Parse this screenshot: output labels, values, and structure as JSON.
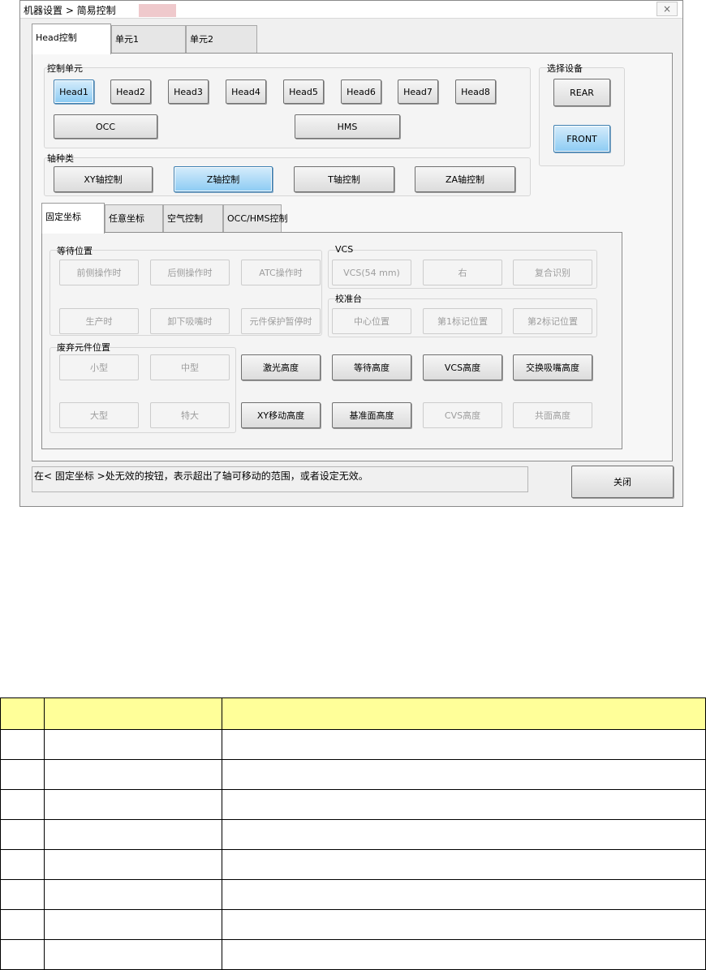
{
  "window": {
    "title": "机器设置 > 简易控制",
    "close_icon": "×"
  },
  "top_tabs": [
    "Head控制",
    "单元1",
    "单元2"
  ],
  "control_unit": {
    "label": "控制单元",
    "heads": [
      "Head1",
      "Head2",
      "Head3",
      "Head4",
      "Head5",
      "Head6",
      "Head7",
      "Head8"
    ],
    "occ": "OCC",
    "hms": "HMS"
  },
  "select_device": {
    "label": "选择设备",
    "rear": "REAR",
    "front": "FRONT"
  },
  "axis_group": {
    "label": "轴种类",
    "buttons": [
      "XY轴控制",
      "Z轴控制",
      "T轴控制",
      "ZA轴控制"
    ]
  },
  "inner_tabs": [
    "固定坐标",
    "任意坐标",
    "空气控制",
    "OCC/HMS控制"
  ],
  "wait_position": {
    "label": "等待位置",
    "buttons": [
      "前侧操作时",
      "后侧操作时",
      "ATC操作时",
      "生产时",
      "卸下吸嘴时",
      "元件保护暂停时"
    ]
  },
  "vcs": {
    "label": "VCS",
    "buttons": [
      "VCS(54 mm)",
      "右",
      "复合识别"
    ]
  },
  "calibration": {
    "label": "校准台",
    "buttons": [
      "中心位置",
      "第1标记位置",
      "第2标记位置"
    ]
  },
  "discard": {
    "label": "废弃元件位置",
    "buttons": [
      "小型",
      "中型",
      "大型",
      "特大"
    ]
  },
  "height_buttons": [
    "激光高度",
    "等待高度",
    "VCS高度",
    "交换吸嘴高度",
    "XY移动高度",
    "基准面高度",
    "CVS高度",
    "共面高度"
  ],
  "status_text": "在< 固定坐标 >处无效的按钮，表示超出了轴可移动的范围，或者设定无效。",
  "close_button": "关闭",
  "colors": {
    "selected": "#8ccbf3",
    "table_header": "#ffff99"
  }
}
